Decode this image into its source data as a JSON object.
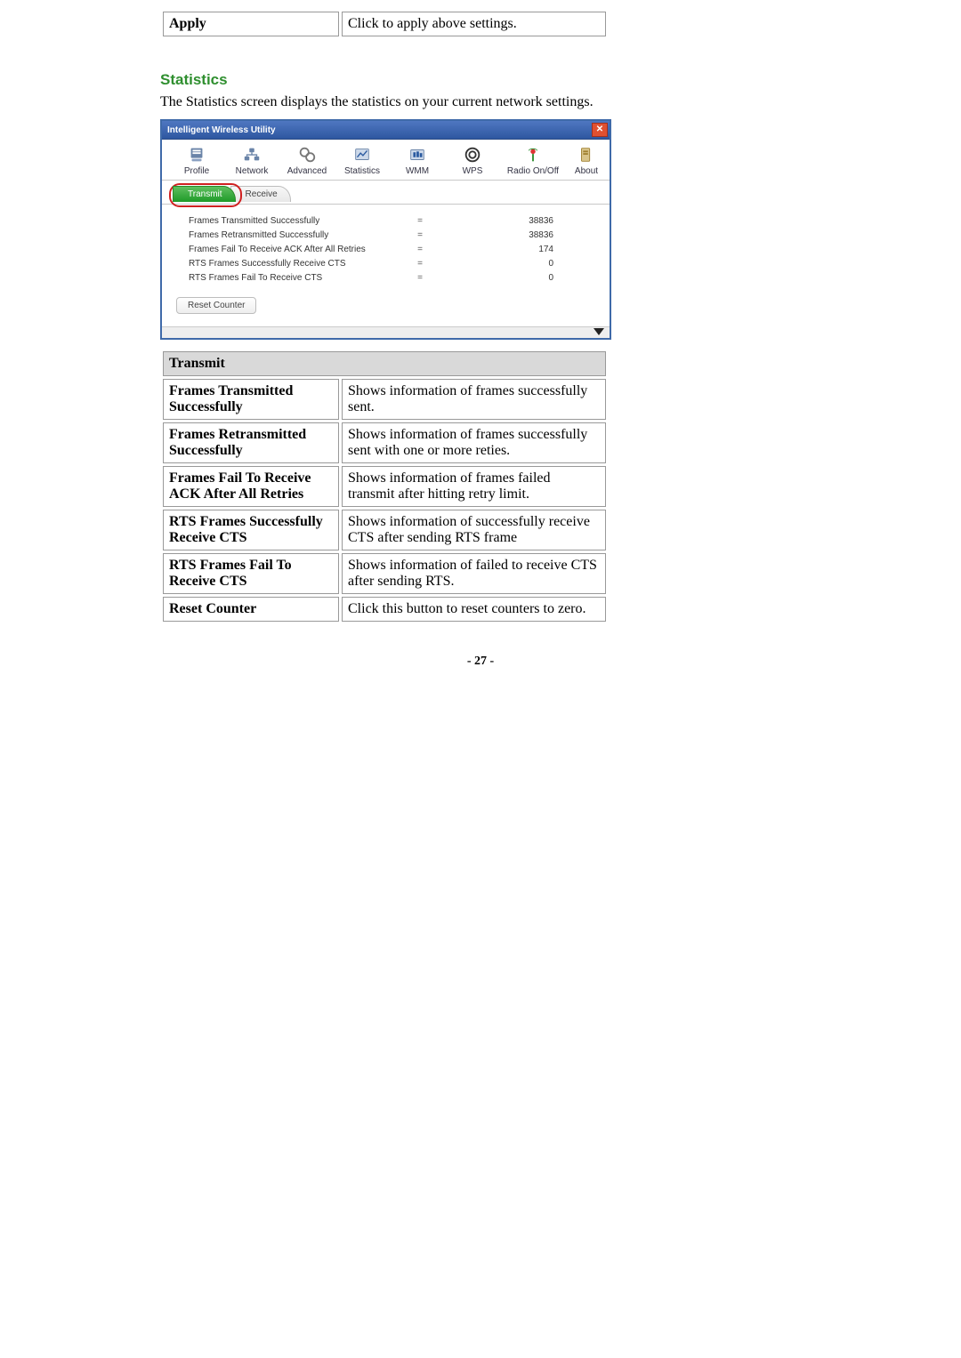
{
  "top_table": {
    "label": "Apply",
    "desc": "Click to apply above settings."
  },
  "heading": "Statistics",
  "blurb": "The Statistics screen displays the statistics on your current network settings.",
  "app": {
    "title": "Intelligent Wireless Utility",
    "close_glyph": "✕",
    "toolbar": [
      {
        "label": "Profile",
        "icon": "profile"
      },
      {
        "label": "Network",
        "icon": "network"
      },
      {
        "label": "Advanced",
        "icon": "advanced"
      },
      {
        "label": "Statistics",
        "icon": "statistics"
      },
      {
        "label": "WMM",
        "icon": "wmm"
      },
      {
        "label": "WPS",
        "icon": "wps"
      },
      {
        "label": "Radio On/Off",
        "icon": "radio"
      },
      {
        "label": "About",
        "icon": "about"
      }
    ],
    "tabs": {
      "active": "Transmit",
      "inactive": "Receive"
    },
    "rows": [
      {
        "label": "Frames Transmitted Successfully",
        "value": "38836"
      },
      {
        "label": "Frames Retransmitted Successfully",
        "value": "38836"
      },
      {
        "label": "Frames Fail To Receive ACK After All Retries",
        "value": "174"
      },
      {
        "label": "RTS Frames Successfully Receive CTS",
        "value": "0"
      },
      {
        "label": "RTS Frames Fail To Receive CTS",
        "value": "0"
      }
    ],
    "equals": "=",
    "reset_label": "Reset Counter"
  },
  "table": {
    "header": "Transmit",
    "rows": [
      {
        "label": "Frames Transmitted Successfully",
        "desc": "Shows information of frames successfully sent."
      },
      {
        "label": "Frames Retransmitted Successfully",
        "desc": "Shows information of frames successfully sent with one or more reties."
      },
      {
        "label": "Frames Fail To Receive ACK After All Retries",
        "desc": "Shows information of frames failed transmit after hitting retry limit."
      },
      {
        "label": "RTS Frames Successfully Receive CTS",
        "desc": "Shows information of successfully receive CTS after sending RTS frame"
      },
      {
        "label": "RTS Frames Fail To Receive CTS",
        "desc": "Shows information of failed to receive CTS after sending RTS."
      },
      {
        "label": "Reset Counter",
        "desc": "Click this button to reset counters to zero."
      }
    ]
  },
  "page_number": "- 27 -"
}
